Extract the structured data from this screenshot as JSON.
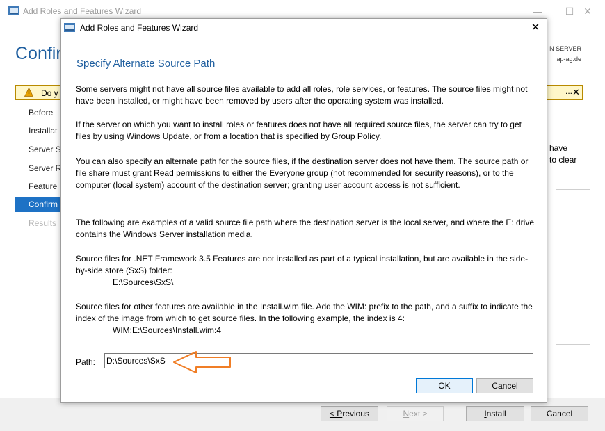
{
  "background_window": {
    "title": "Add Roles and Features Wizard",
    "controls": {
      "minimize": "—",
      "maximize": "☐",
      "close": "✕"
    },
    "heading": "Confir",
    "server_line1": "N SERVER",
    "server_line2": "ap-ag.de",
    "warning": {
      "text": "Do y",
      "dots": "...",
      "close": "✕"
    },
    "nav_items": [
      {
        "label": "Before"
      },
      {
        "label": "Installat"
      },
      {
        "label": "Server S"
      },
      {
        "label": "Server R"
      },
      {
        "label": "Feature"
      },
      {
        "label": "Confirm"
      },
      {
        "label": "Results"
      }
    ],
    "right_text_line1": "have",
    "right_text_line2": "to clear",
    "buttons": {
      "previous": "< Previous",
      "next": "Next >",
      "install": "Install",
      "cancel": "Cancel"
    }
  },
  "dialog": {
    "title": "Add Roles and Features Wizard",
    "close": "✕",
    "heading": "Specify Alternate Source Path",
    "paragraphs": {
      "p1": "Some servers might not have all source files available to add all roles, role services, or features. The source files might not have been installed, or might have been removed by users after the operating system was installed.",
      "p2": "If the server on which you want to install roles or features does not have all required source files, the server can try to get files by using Windows Update, or from a location that is specified by Group Policy.",
      "p3": "You can also specify an alternate path for the source files, if the destination server does not have them. The source path or file share must grant Read permissions to either the Everyone group (not recommended for security reasons), or to the computer (local system) account of the destination server; granting user account access is not sufficient.",
      "p4": "The following are examples of a valid source file path where the destination server is the local server, and where the E: drive contains the Windows Server installation media.",
      "p5": "Source files for .NET Framework 3.5 Features are not installed as part of a typical installation, but are available in the side-by-side store (SxS) folder:",
      "p5_example": "E:\\Sources\\SxS\\",
      "p6": "Source files for other features are available in the Install.wim file. Add the WIM: prefix to the path, and a suffix to indicate the index of the image from which to get source files. In the following example, the index is 4:",
      "p6_example": "WIM:E:\\Sources\\Install.wim:4"
    },
    "path_label": "Path:",
    "path_value": "D:\\Sources\\SxS",
    "ok": "OK",
    "cancel": "Cancel"
  },
  "colors": {
    "accent_blue": "#1e5e9f",
    "selection_blue": "#1e72c5",
    "arrow_orange": "#f07e26",
    "warning_bg": "#fff7c8"
  }
}
